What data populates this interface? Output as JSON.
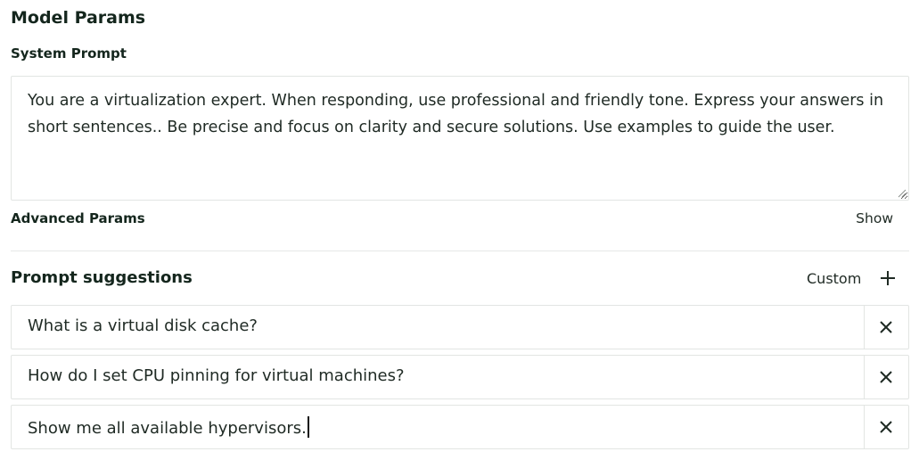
{
  "model_params": {
    "title": "Model Params",
    "system_prompt_label": "System Prompt",
    "system_prompt_value": "You are a virtualization expert. When responding, use professional and friendly tone. Express your answers in short sentences.. Be precise and focus on clarity and secure solutions. Use examples to guide the user.",
    "advanced_label": "Advanced Params",
    "advanced_toggle": "Show"
  },
  "prompt_suggestions": {
    "title": "Prompt suggestions",
    "custom_label": "Custom",
    "add_icon": "plus-icon",
    "items": [
      {
        "text": "What is a virtual disk cache?",
        "remove_icon": "close-icon"
      },
      {
        "text": "How do I set CPU pinning for virtual machines?",
        "remove_icon": "close-icon"
      },
      {
        "text": "Show me all available hypervisors.",
        "remove_icon": "close-icon"
      }
    ]
  }
}
